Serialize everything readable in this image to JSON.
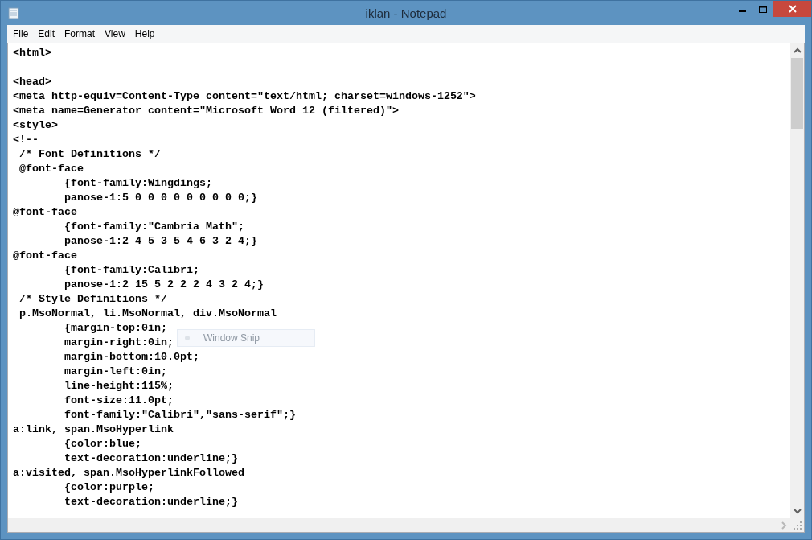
{
  "window": {
    "title": "iklan - Notepad"
  },
  "menu": [
    {
      "label": "File"
    },
    {
      "label": "Edit"
    },
    {
      "label": "Format"
    },
    {
      "label": "View"
    },
    {
      "label": "Help"
    }
  ],
  "editor": {
    "lines": [
      {
        "kind": "code",
        "text": "<html>"
      },
      {
        "kind": "blank"
      },
      {
        "kind": "code",
        "text": "<head>"
      },
      {
        "kind": "code",
        "text": "<meta http-equiv=Content-Type content=\"text/html; charset=windows-1252\">"
      },
      {
        "kind": "code",
        "text": "<meta name=Generator content=\"Microsoft Word 12 (filtered)\">"
      },
      {
        "kind": "code",
        "text": "<style>"
      },
      {
        "kind": "code",
        "text": "<!--"
      },
      {
        "kind": "code",
        "text": " /* Font Definitions */"
      },
      {
        "kind": "code",
        "text": " @font-face"
      },
      {
        "kind": "code",
        "text": "\t{font-family:Wingdings;"
      },
      {
        "kind": "code",
        "text": "\tpanose-1:5 0 0 0 0 0 0 0 0 0;}"
      },
      {
        "kind": "code",
        "text": "@font-face"
      },
      {
        "kind": "code",
        "text": "\t{font-family:\"Cambria Math\";"
      },
      {
        "kind": "code",
        "text": "\tpanose-1:2 4 5 3 5 4 6 3 2 4;}"
      },
      {
        "kind": "code",
        "text": "@font-face"
      },
      {
        "kind": "code",
        "text": "\t{font-family:Calibri;"
      },
      {
        "kind": "code",
        "text": "\tpanose-1:2 15 5 2 2 2 4 3 2 4;}"
      },
      {
        "kind": "code",
        "text": " /* Style Definitions */"
      },
      {
        "kind": "code",
        "text": " p.MsoNormal, li.MsoNormal, div.MsoNormal"
      },
      {
        "kind": "code",
        "text": "\t{margin-top:0in;"
      },
      {
        "kind": "code",
        "text": "\tmargin-right:0in;"
      },
      {
        "kind": "code",
        "text": "\tmargin-bottom:10.0pt;"
      },
      {
        "kind": "code",
        "text": "\tmargin-left:0in;"
      },
      {
        "kind": "code",
        "text": "\tline-height:115%;"
      },
      {
        "kind": "code",
        "text": "\tfont-size:11.0pt;"
      },
      {
        "kind": "code",
        "text": "\tfont-family:\"Calibri\",\"sans-serif\";}"
      },
      {
        "kind": "code",
        "text": "a:link, span.MsoHyperlink"
      },
      {
        "kind": "code",
        "text": "\t{color:blue;"
      },
      {
        "kind": "code",
        "text": "\ttext-decoration:underline;}"
      },
      {
        "kind": "code",
        "text": "a:visited, span.MsoHyperlinkFollowed"
      },
      {
        "kind": "code",
        "text": "\t{color:purple;"
      },
      {
        "kind": "code",
        "text": "\ttext-decoration:underline;}"
      }
    ]
  },
  "snip_tooltip": {
    "label": "Window Snip"
  }
}
